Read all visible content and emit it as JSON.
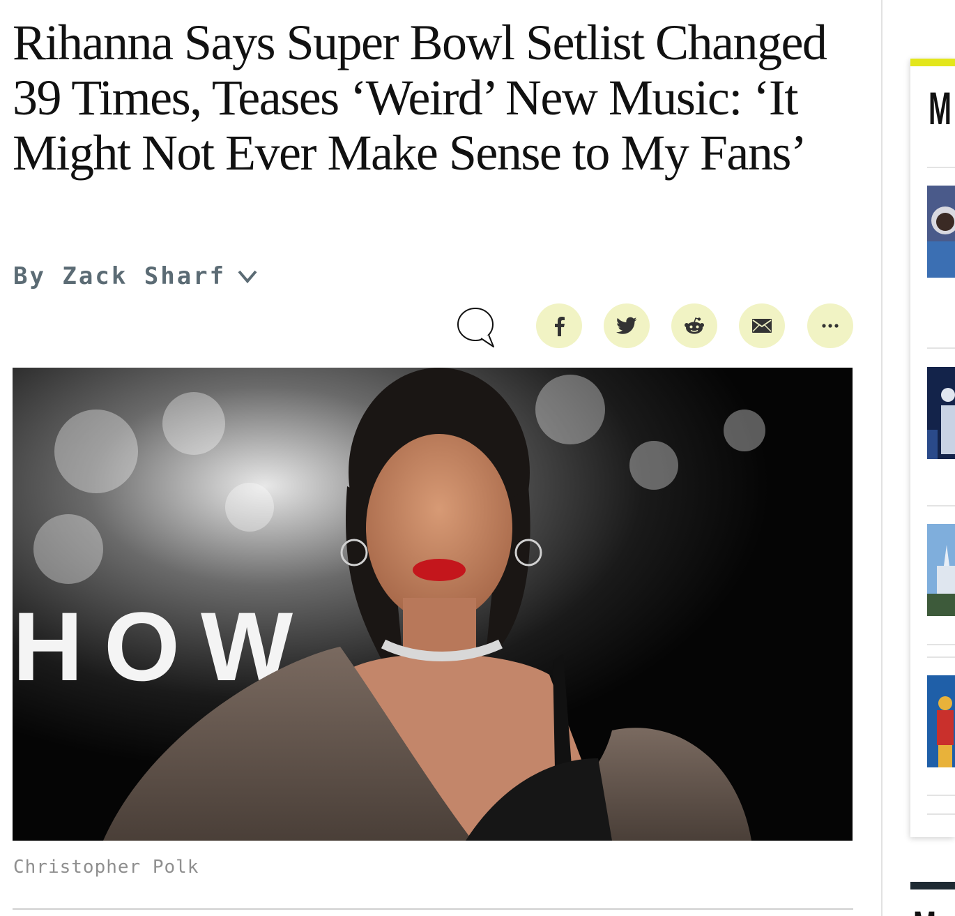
{
  "article": {
    "headline": "Rihanna Says Super Bowl Setlist Changed 39 Times, Teases ‘Weird’ New Music: ‘It Might Not Ever Make Sense to My Fans’",
    "byline": "By Zack Sharf",
    "image_credit": "Christopher Polk",
    "hero_backdrop_text": "HOW"
  },
  "share": {
    "buttons": [
      {
        "name": "facebook",
        "icon": "facebook-icon"
      },
      {
        "name": "twitter",
        "icon": "twitter-icon"
      },
      {
        "name": "reddit",
        "icon": "reddit-icon"
      },
      {
        "name": "email",
        "icon": "email-icon"
      },
      {
        "name": "more",
        "icon": "more-icon"
      }
    ],
    "comment_icon": "comment-icon"
  },
  "sidebar": {
    "section_title_partial": "M",
    "second_section_title_partial": "M"
  },
  "colors": {
    "accent_yellow": "#e3e61b",
    "share_button_bg": "#f1f3c4",
    "byline_color": "#5b6b74",
    "dark_bar": "#1f2b33"
  }
}
